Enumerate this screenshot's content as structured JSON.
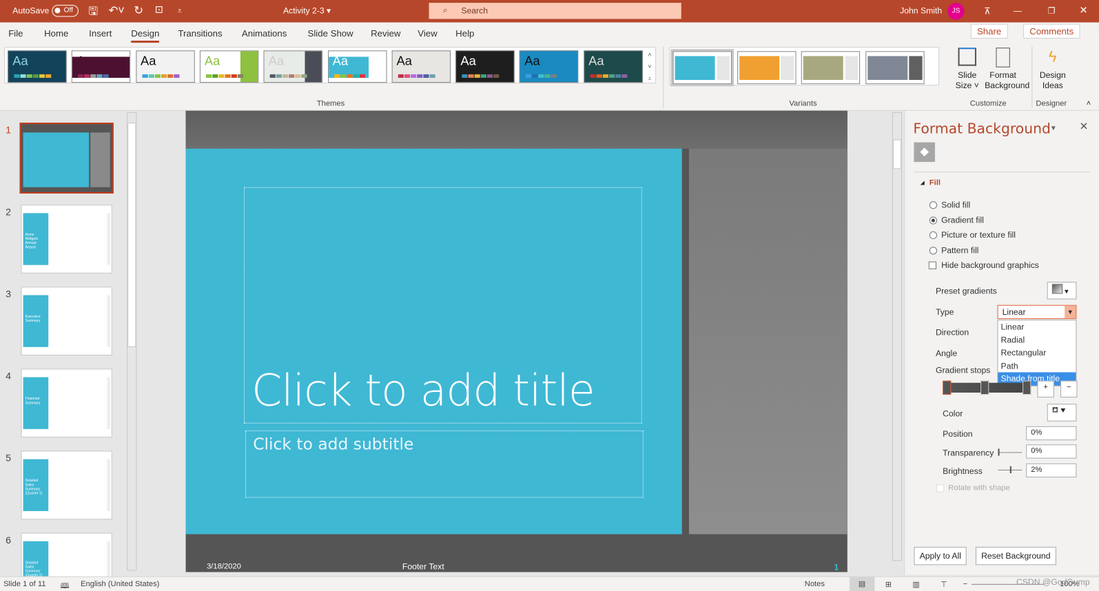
{
  "titlebar": {
    "autosave": "AutoSave",
    "autosave_state": "Off",
    "doc_title": "Activity 2-3 ▾",
    "search_placeholder": "Search",
    "user": "John Smith",
    "initials": "JS"
  },
  "menu": [
    "File",
    "Home",
    "Insert",
    "Design",
    "Transitions",
    "Animations",
    "Slide Show",
    "Review",
    "View",
    "Help"
  ],
  "active_tab": "Design",
  "actions": {
    "share": "Share",
    "comments": "Comments"
  },
  "themes": [
    {
      "bg": "#12435a",
      "fg": "#8fd3e0",
      "sw": [
        "#2aa4b8",
        "#8de0d6",
        "#7fc257",
        "#5a9a3d",
        "#e6c437",
        "#f0a630"
      ]
    },
    {
      "bg": "#fff",
      "fg": "#4c1130",
      "sw": [
        "#8a2a55",
        "#b33060",
        "#999",
        "#6aa2c2",
        "#4a6ea8"
      ],
      "band": "#4c1130"
    },
    {
      "bg": "#f2f2f2",
      "fg": "#111",
      "sw": [
        "#3aa0e0",
        "#5bc8b0",
        "#8bc34a",
        "#e0a030",
        "#e07030",
        "#a060d0"
      ]
    },
    {
      "bg": "#fff",
      "fg": "#8dc13f",
      "sw": [
        "#8dc13f",
        "#5aa02c",
        "#e8b820",
        "#e07820",
        "#d04020",
        "#8a8060"
      ],
      "accent": "#8dc13f"
    },
    {
      "bg": "#e8ece8",
      "fg": "#ccc",
      "sw": [
        "#555a66",
        "#7aa0a0",
        "#c0b8a0",
        "#b08070",
        "#d8c090",
        "#90a888"
      ],
      "accent": "#4a4d57"
    },
    {
      "bg": "#fff",
      "fg": "#fff",
      "sw": [
        "#f5b800",
        "#8dc13f",
        "#f07020",
        "#20b0a0",
        "#e03040"
      ],
      "band": "#3fb8d4"
    },
    {
      "bg": "#e8e6e2",
      "fg": "#111",
      "sw": [
        "#c0304a",
        "#e05080",
        "#b070e0",
        "#8060c0",
        "#5060a0",
        "#70a0b0"
      ]
    },
    {
      "bg": "#1e1e1e",
      "fg": "#fff",
      "sw": [
        "#3a90c0",
        "#e08050",
        "#e0b040",
        "#40a080",
        "#8a5a8a",
        "#705a40"
      ]
    },
    {
      "bg": "#1a8ac0",
      "fg": "#111",
      "sw": [
        "#3aa0e0",
        "#2070b0",
        "#40c0d0",
        "#50b090",
        "#808080"
      ]
    },
    {
      "bg": "#1d4a4a",
      "fg": "#ddd",
      "sw": [
        "#c03030",
        "#e06020",
        "#e0b030",
        "#50a090",
        "#5080a0",
        "#9060a0"
      ]
    }
  ],
  "themes_label": "Themes",
  "variants": [
    {
      "main": "#3fb8d4",
      "side": "#e6e6e6"
    },
    {
      "main": "#f0a030",
      "side": "#e6e6e6"
    },
    {
      "main": "#a8a880",
      "side": "#e6e6e6"
    },
    {
      "main": "#808898",
      "side": "#606060"
    }
  ],
  "variants_label": "Variants",
  "customize": {
    "slide_size": "Slide Size ˅",
    "format_background": "Format Background",
    "label": "Customize"
  },
  "designer": {
    "design_ideas": "Design Ideas",
    "label": "Designer"
  },
  "slides": [
    {
      "num": "1",
      "text": ""
    },
    {
      "num": "2",
      "text": "Acme Widgets Annual Report"
    },
    {
      "num": "3",
      "text": "Executive Summary"
    },
    {
      "num": "4",
      "text": "Financial Summary"
    },
    {
      "num": "5",
      "text": "Detailed Sales Summary (Quarter 1)"
    },
    {
      "num": "6",
      "text": "Detailed Sales Summary (Quarter 2)"
    }
  ],
  "slide": {
    "title": "Click to add title",
    "subtitle": "Click to add subtitle",
    "date": "3/18/2020",
    "footer": "Footer Text",
    "page": "1",
    "accent": "#3fb8d4"
  },
  "pane": {
    "title": "Format Background",
    "section": "Fill",
    "options": [
      "Solid fill",
      "Gradient fill",
      "Picture or texture fill",
      "Pattern fill"
    ],
    "selected": "Gradient fill",
    "hide_bg": "Hide background graphics",
    "preset": "Preset gradients",
    "type_label": "Type",
    "type_value": "Linear",
    "type_options": [
      "Linear",
      "Radial",
      "Rectangular",
      "Path",
      "Shade from title"
    ],
    "highlighted": "Shade from title",
    "direction": "Direction",
    "angle": "Angle",
    "stops": "Gradient stops",
    "color": "Color",
    "position": "Position",
    "position_val": "0%",
    "transparency": "Transparency",
    "transparency_val": "0%",
    "brightness": "Brightness",
    "brightness_val": "2%",
    "rotate": "Rotate with shape",
    "apply_all": "Apply to All",
    "reset": "Reset Background"
  },
  "status": {
    "slide": "Slide 1 of 11",
    "language": "English (United States)",
    "notes": "Notes",
    "zoom": "100%",
    "watermark": "CSDN @GodGump"
  }
}
